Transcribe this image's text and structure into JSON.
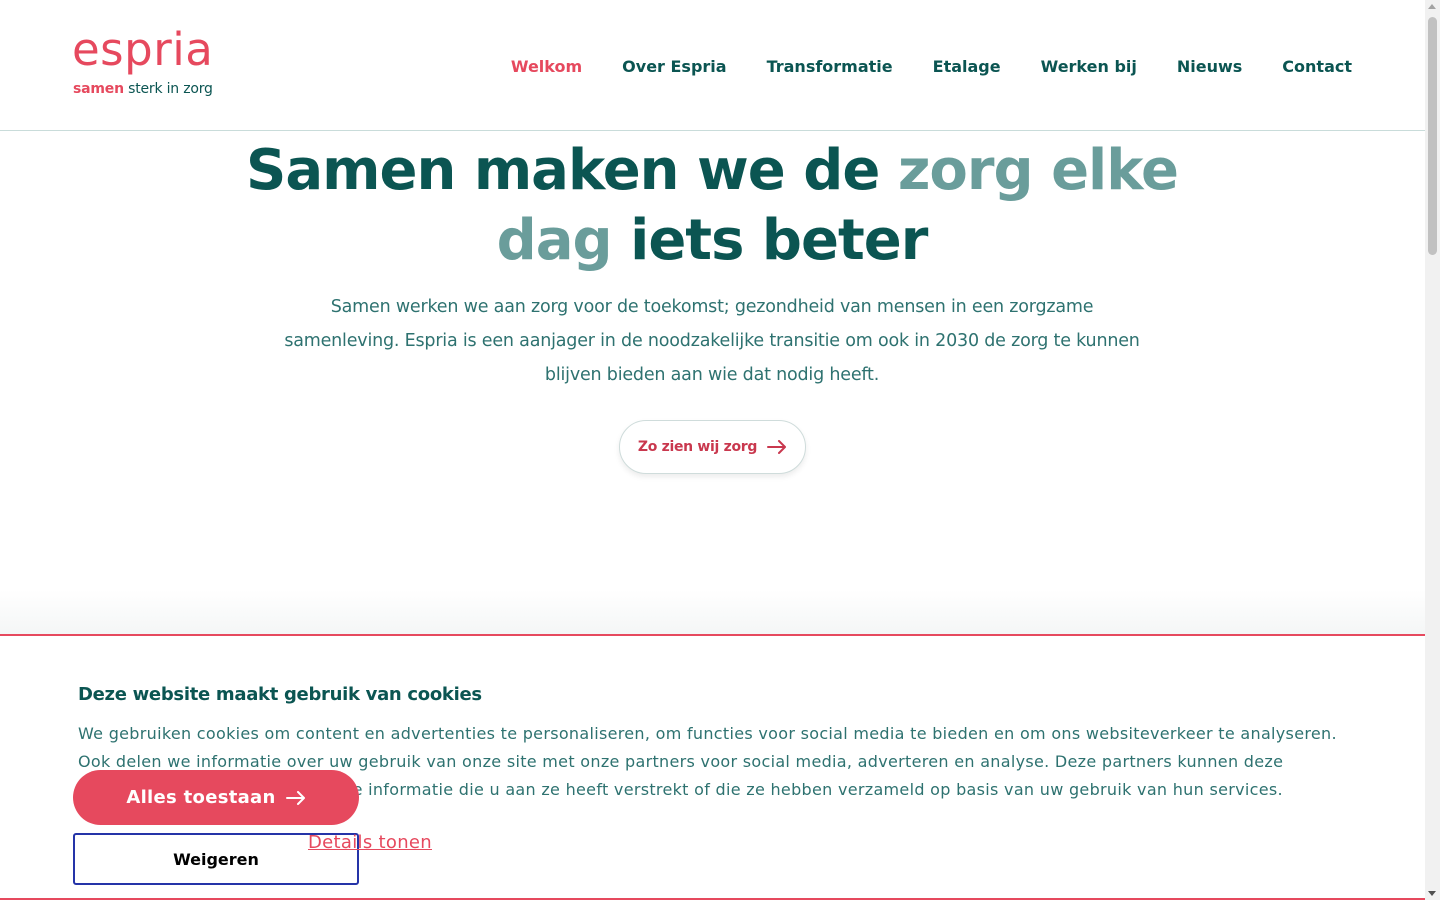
{
  "brand": {
    "name": "espria",
    "tagline_strong": "samen",
    "tagline_rest": " sterk in zorg",
    "primary_color": "#e6495e",
    "text_color": "#0b5552",
    "accent_color": "#6a9d9b"
  },
  "nav": {
    "items": [
      {
        "label": "Welkom",
        "active": true
      },
      {
        "label": "Over Espria",
        "active": false
      },
      {
        "label": "Transformatie",
        "active": false
      },
      {
        "label": "Etalage",
        "active": false
      },
      {
        "label": "Werken bij",
        "active": false
      },
      {
        "label": "Nieuws",
        "active": false
      },
      {
        "label": "Contact",
        "active": false
      }
    ]
  },
  "hero": {
    "title_part1": "Samen maken we de ",
    "title_accent": "zorg elke dag",
    "title_part2": " iets beter",
    "text": "Samen werken we aan zorg voor de toekomst; gezondheid van mensen in een zorgzame samenleving. Espria is een aanjager in de noodzakelijke transitie om ook in 2030 de zorg te kunnen blijven bieden aan wie dat nodig heeft.",
    "button_label": "Zo zien wij zorg",
    "button_icon": "arrow-right-icon"
  },
  "cookie": {
    "title": "Deze website maakt gebruik van cookies",
    "text": "We gebruiken cookies om content en advertenties te personaliseren, om functies voor social media te bieden en om ons websiteverkeer te analyseren. Ook delen we informatie over uw gebruik van onze site met onze partners voor social media, adverteren en analyse. Deze partners kunnen deze gegevens combineren met andere informatie die u aan ze heeft verstrekt of die ze hebben verzameld op basis van uw gebruik van hun services.",
    "accept_label": "Alles toestaan",
    "decline_label": "Weigeren",
    "details_label": "Details tonen"
  }
}
